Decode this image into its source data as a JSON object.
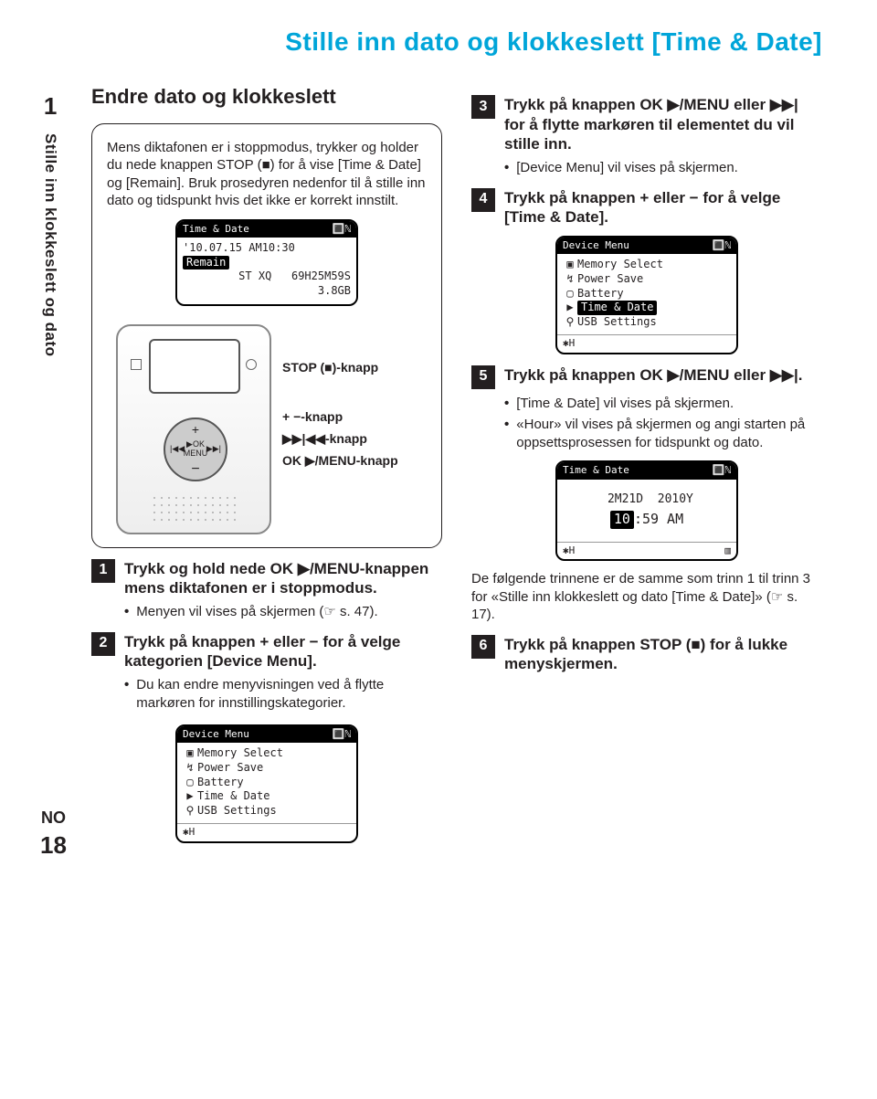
{
  "title": "Stille inn dato og klokkeslett [Time & Date]",
  "sidebar": {
    "chapter": "1",
    "label": "Stille inn klokkeslett og dato",
    "lang": "NO",
    "page": "18"
  },
  "left": {
    "heading": "Endre dato og klokkeslett",
    "intro1": "Mens diktafonen er i stoppmodus, trykker og holder du nede knappen STOP (■) for å vise [Time & Date] og [Remain]. Bruk prosedyren nedenfor til å stille inn dato og tidspunkt hvis det ikke er korrekt innstilt.",
    "screenA": {
      "head_l": "Time & Date",
      "head_r": "🔳ℕ",
      "line1": "'10.07.15 AM10:30",
      "line2label": "Remain",
      "line3": "ST XQ   69H25M59S",
      "line4": "           3.8GB"
    },
    "callouts": {
      "stop": "STOP (■)-knapp",
      "pm": "+ −-knapp",
      "ffrw": "▶▶|◀◀-knapp",
      "okmenu": "OK ▶/MENU-knapp"
    },
    "step1": "Trykk og hold nede OK ▶/MENU-knappen mens diktafonen er i stoppmodus.",
    "step1_b": "Menyen vil vises på skjermen (☞ s. 47).",
    "step2": "Trykk på knappen + eller − for å velge kategorien [Device Menu].",
    "step2_b": "Du kan endre menyvisningen ved å flytte markøren for innstillingskategorier."
  },
  "right": {
    "step3": "Trykk på knappen OK ▶/MENU eller ▶▶| for å flytte markøren til elementet du vil stille inn.",
    "step3_b": "[Device Menu] vil vises på skjermen.",
    "step4": "Trykk på knappen + eller − for å velge [Time & Date].",
    "deviceMenu": {
      "head_l": "Device Menu",
      "head_r": "🔳ℕ",
      "items": [
        "Memory Select",
        "Power Save",
        "Battery",
        "Time & Date",
        "USB Settings"
      ],
      "selectedIndex": 3
    },
    "step5": "Trykk på knappen OK ▶/MENU eller ▶▶|.",
    "step5_b1": "[Time & Date] vil vises på skjermen.",
    "step5_b2": "«Hour» vil vises på skjermen og angi starten på oppsettsprosessen for tidspunkt og dato.",
    "timeDate": {
      "head_l": "Time & Date",
      "head_r": "🔳ℕ",
      "line1": " 2M21D  2010Y",
      "line2": "10:59 AM"
    },
    "para1": "De følgende trinnene er de samme som trinn 1 til trinn 3 for «Stille inn klokkeslett og dato [Time & Date]» (☞ s. 17).",
    "step6": "Trykk på knappen STOP (■) for å lukke menyskjermen."
  }
}
